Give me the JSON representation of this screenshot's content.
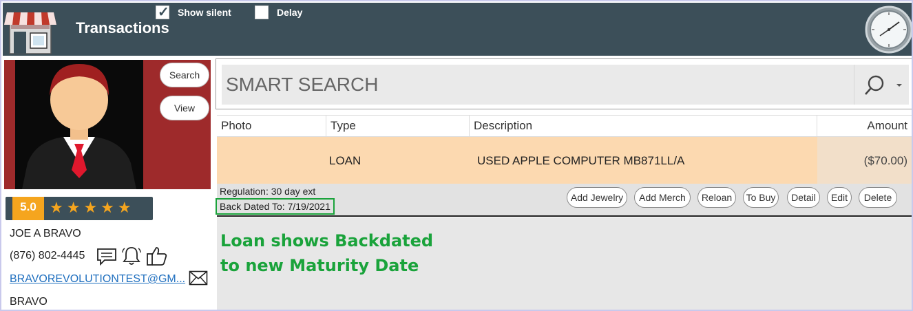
{
  "header": {
    "title": "Transactions",
    "show_silent_label": "Show silent",
    "show_silent_checked": true,
    "delay_label": "Delay",
    "delay_checked": false,
    "checkmark": "✓"
  },
  "customer": {
    "search_label": "Search",
    "view_label": "View",
    "rating": "5.0",
    "stars": "★★★★★",
    "name": "JOE A BRAVO",
    "phone": "(876) 802-4445",
    "email": "BRAVOREVOLUTIONTEST@GM...",
    "organization": "BRAVO"
  },
  "search": {
    "placeholder": "SMART SEARCH"
  },
  "grid": {
    "columns": [
      "Photo",
      "Type",
      "Description",
      "Amount"
    ],
    "rows": [
      {
        "photo": "",
        "type": "LOAN",
        "description": "USED APPLE COMPUTER MB871LL/A",
        "amount": "($70.00)"
      }
    ]
  },
  "details": {
    "regulation": "Regulation: 30 day ext",
    "back_dated": "Back Dated To: 7/19/2021"
  },
  "actions": [
    "Add Jewelry",
    "Add Merch",
    "Reloan",
    "To Buy",
    "Detail",
    "Edit",
    "Delete"
  ],
  "annotation": {
    "line1": "Loan shows Backdated",
    "line2": "to new Maturity Date"
  },
  "colors": {
    "header_bg": "#3c4f59",
    "rating_orange": "#f5a51e",
    "row_highlight": "#fcd9b0",
    "annotation_green": "#1aa33b",
    "photo_bg": "#9e2a2b"
  },
  "icons": [
    "store-icon",
    "clock-icon",
    "chat-icon",
    "bell-icon",
    "thumbs-up-icon",
    "mail-icon",
    "search-icon",
    "chevron-down-icon"
  ]
}
